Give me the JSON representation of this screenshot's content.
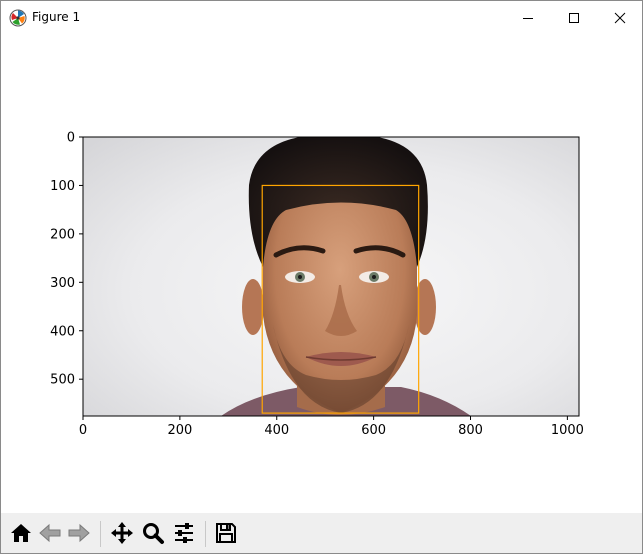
{
  "window": {
    "title": "Figure 1",
    "controls": {
      "minimize_icon": "minimize-icon",
      "maximize_icon": "maximize-icon",
      "close_icon": "close-icon"
    }
  },
  "chart_data": {
    "type": "image",
    "title": "",
    "xlabel": "",
    "ylabel": "",
    "xlim": [
      0,
      1024
    ],
    "ylim": [
      576,
      0
    ],
    "x_ticks": [
      "0",
      "200",
      "400",
      "600",
      "800",
      "1000"
    ],
    "y_ticks": [
      "0",
      "100",
      "200",
      "300",
      "400",
      "500"
    ],
    "image_content": "portrait photo of a man's face on a light grey background",
    "annotations": [
      {
        "type": "rectangle",
        "label": "",
        "x_min": 370,
        "y_min": 100,
        "x_max": 693,
        "y_max": 570,
        "color": "#ffa500"
      }
    ]
  },
  "toolbar": {
    "buttons": [
      {
        "name": "home",
        "icon": "home-icon"
      },
      {
        "name": "back",
        "icon": "back-arrow-icon"
      },
      {
        "name": "forward",
        "icon": "forward-arrow-icon"
      },
      {
        "name": "pan",
        "icon": "pan-icon"
      },
      {
        "name": "zoom",
        "icon": "zoom-icon"
      },
      {
        "name": "configure-subplots",
        "icon": "sliders-icon"
      },
      {
        "name": "save",
        "icon": "save-icon"
      }
    ]
  },
  "colors": {
    "bbox": "#ffa500",
    "toolbar_bg": "#efefef",
    "axis": "#000000"
  }
}
